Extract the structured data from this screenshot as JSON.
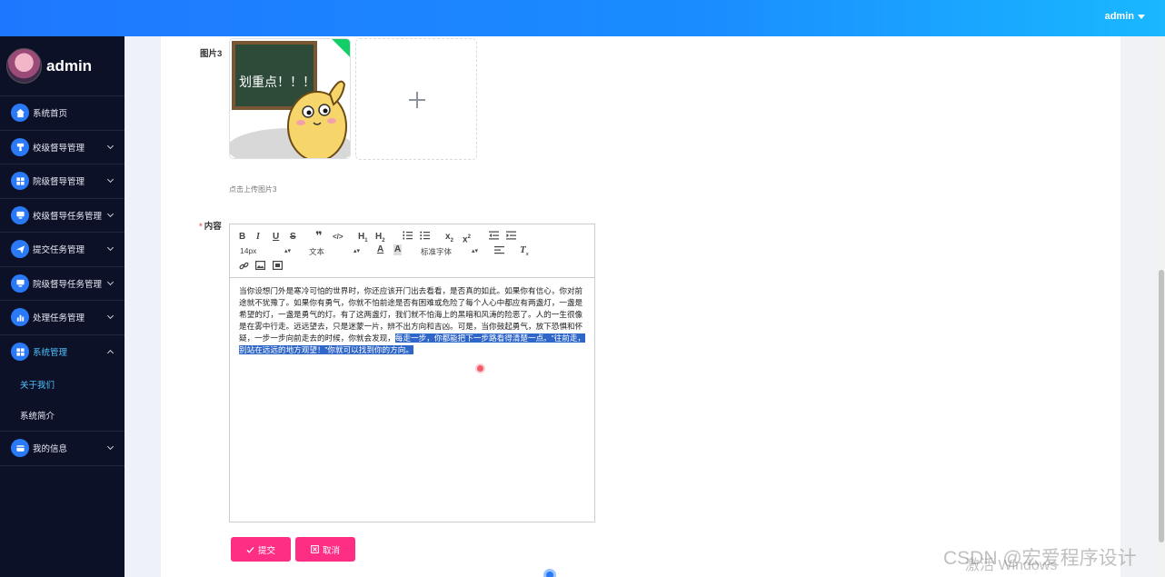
{
  "header": {
    "user": "admin"
  },
  "sidebar": {
    "profile_name": "admin",
    "items": [
      {
        "label": "系统首页",
        "icon": "home-icon"
      },
      {
        "label": "校级督导管理",
        "icon": "user-tie-icon"
      },
      {
        "label": "院级督导管理",
        "icon": "grid-icon"
      },
      {
        "label": "校级督导任务管理",
        "icon": "monitor-icon"
      },
      {
        "label": "提交任务管理",
        "icon": "send-icon"
      },
      {
        "label": "院级督导任务管理",
        "icon": "monitor-icon"
      },
      {
        "label": "处理任务管理",
        "icon": "bar-chart-icon"
      },
      {
        "label": "系统管理",
        "icon": "grid-icon"
      },
      {
        "label": "我的信息",
        "icon": "card-icon"
      }
    ],
    "sub_items": [
      "关于我们",
      "系统简介"
    ]
  },
  "form": {
    "image_label": "图片3",
    "image_text": "划重点！！！",
    "upload_tip": "点击上传图片3",
    "content_label": "内容",
    "required_mark": "*",
    "submit_label": "提交",
    "cancel_label": "取消"
  },
  "editor": {
    "font_size": "14px",
    "text_type": "文本",
    "font_family": "标准字体",
    "body_plain": "当你设想门外是寒冷可怕的世界时，你还应该开门出去看看，是否真的如此。如果你有信心，你对前途就不犹豫了。如果你有勇气，你就不怕前途是否有困难或危险了每个人心中都应有两盏灯，一盏是希望的灯，一盏是勇气的灯。有了这两盏灯，我们就不怕海上的黑暗和风涛的险恶了。人的一生很像是在雾中行走。远远望去，只是迷蒙一片，辨不出方向和吉凶。可是，当你鼓起勇气，放下恐惧和怀疑，一步一步向前走去的时候，你就会发现，",
    "body_selected": "每走一步，你都能把下一步路看得清楚一点。“往前走，别站在远远的地方观望！”你就可以找到你的方向。"
  },
  "watermark": {
    "text": "CSDN @宏爱程序设计",
    "activate": "激活 Windows"
  }
}
